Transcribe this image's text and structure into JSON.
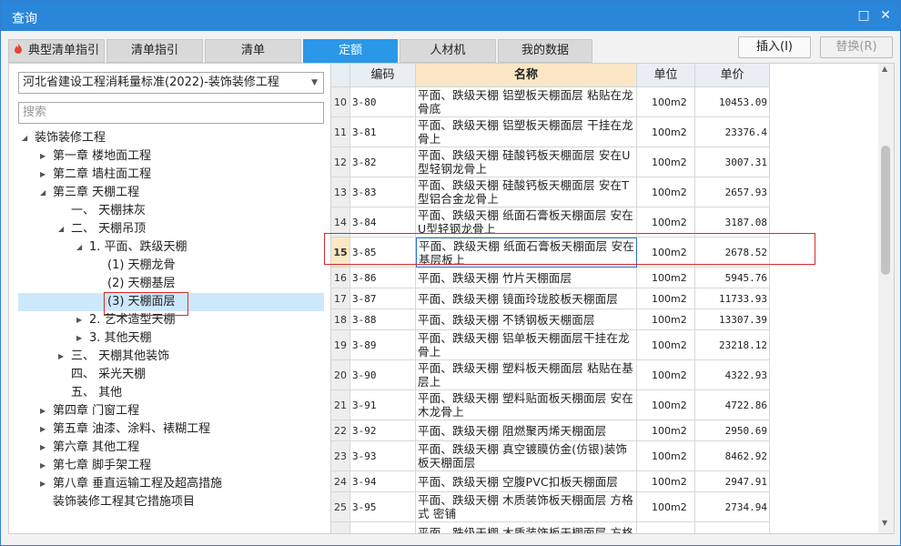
{
  "window": {
    "title": "查询"
  },
  "tabs": [
    {
      "label": "典型清单指引",
      "active": false
    },
    {
      "label": "清单指引",
      "active": false
    },
    {
      "label": "清单",
      "active": false
    },
    {
      "label": "定额",
      "active": true
    },
    {
      "label": "人材机",
      "active": false
    },
    {
      "label": "我的数据",
      "active": false
    }
  ],
  "buttons": {
    "insert": "插入(I)",
    "replace": "替换(R)"
  },
  "left": {
    "select_value": "河北省建设工程消耗量标准(2022)-装饰装修工程",
    "search_placeholder": "搜索",
    "tree": [
      {
        "label": "装饰装修工程",
        "level": 0,
        "toggle": "expanded"
      },
      {
        "label": "第一章 楼地面工程",
        "level": 1,
        "toggle": "collapsed"
      },
      {
        "label": "第二章 墙柱面工程",
        "level": 1,
        "toggle": "collapsed"
      },
      {
        "label": "第三章 天棚工程",
        "level": 1,
        "toggle": "expanded"
      },
      {
        "label": "一、 天棚抹灰",
        "level": 2,
        "toggle": "none"
      },
      {
        "label": "二、 天棚吊顶",
        "level": 2,
        "toggle": "expanded"
      },
      {
        "label": "1. 平面、跌级天棚",
        "level": 3,
        "toggle": "expanded"
      },
      {
        "label": "(1) 天棚龙骨",
        "level": 4,
        "toggle": "none"
      },
      {
        "label": "(2) 天棚基层",
        "level": 4,
        "toggle": "none"
      },
      {
        "label": "(3) 天棚面层",
        "level": 4,
        "toggle": "none",
        "selected": true
      },
      {
        "label": "2. 艺术造型天棚",
        "level": 3,
        "toggle": "collapsed"
      },
      {
        "label": "3. 其他天棚",
        "level": 3,
        "toggle": "collapsed"
      },
      {
        "label": "三、 天棚其他装饰",
        "level": 2,
        "toggle": "collapsed"
      },
      {
        "label": "四、 采光天棚",
        "level": 2,
        "toggle": "none"
      },
      {
        "label": "五、 其他",
        "level": 2,
        "toggle": "none"
      },
      {
        "label": "第四章 门窗工程",
        "level": 1,
        "toggle": "collapsed"
      },
      {
        "label": "第五章 油漆、涂料、裱糊工程",
        "level": 1,
        "toggle": "collapsed"
      },
      {
        "label": "第六章 其他工程",
        "level": 1,
        "toggle": "collapsed"
      },
      {
        "label": "第七章 脚手架工程",
        "level": 1,
        "toggle": "collapsed"
      },
      {
        "label": "第八章 垂直运输工程及超高措施",
        "level": 1,
        "toggle": "collapsed"
      },
      {
        "label": "装饰装修工程其它措施项目",
        "level": 1,
        "toggle": "none"
      }
    ]
  },
  "grid": {
    "headers": {
      "code": "编码",
      "name": "名称",
      "unit": "单位",
      "price": "单价"
    },
    "rows": [
      {
        "idx": "10",
        "code": "3-80",
        "name": "平面、跌级天棚 铝塑板天棚面层 粘贴在龙骨底",
        "unit": "100m2",
        "price": "10453.09"
      },
      {
        "idx": "11",
        "code": "3-81",
        "name": "平面、跌级天棚 铝塑板天棚面层 干挂在龙骨上",
        "unit": "100m2",
        "price": "23376.4"
      },
      {
        "idx": "12",
        "code": "3-82",
        "name": "平面、跌级天棚 硅酸钙板天棚面层 安在U型轻钢龙骨上",
        "unit": "100m2",
        "price": "3007.31"
      },
      {
        "idx": "13",
        "code": "3-83",
        "name": "平面、跌级天棚 硅酸钙板天棚面层 安在T型铝合金龙骨上",
        "unit": "100m2",
        "price": "2657.93"
      },
      {
        "idx": "14",
        "code": "3-84",
        "name": "平面、跌级天棚 纸面石膏板天棚面层 安在U型轻钢龙骨上",
        "unit": "100m2",
        "price": "3187.08"
      },
      {
        "idx": "15",
        "code": "3-85",
        "name": "平面、跌级天棚 纸面石膏板天棚面层 安在基层板上",
        "unit": "100m2",
        "price": "2678.52",
        "selected": true
      },
      {
        "idx": "16",
        "code": "3-86",
        "name": "平面、跌级天棚 竹片天棚面层",
        "unit": "100m2",
        "price": "5945.76"
      },
      {
        "idx": "17",
        "code": "3-87",
        "name": "平面、跌级天棚 镜面玲珑胶板天棚面层",
        "unit": "100m2",
        "price": "11733.93"
      },
      {
        "idx": "18",
        "code": "3-88",
        "name": "平面、跌级天棚 不锈钢板天棚面层",
        "unit": "100m2",
        "price": "13307.39"
      },
      {
        "idx": "19",
        "code": "3-89",
        "name": "平面、跌级天棚 铝单板天棚面层干挂在龙骨上",
        "unit": "100m2",
        "price": "23218.12"
      },
      {
        "idx": "20",
        "code": "3-90",
        "name": "平面、跌级天棚 塑料板天棚面层 粘贴在基层上",
        "unit": "100m2",
        "price": "4322.93"
      },
      {
        "idx": "21",
        "code": "3-91",
        "name": "平面、跌级天棚 塑料贴面板天棚面层 安在木龙骨上",
        "unit": "100m2",
        "price": "4722.86"
      },
      {
        "idx": "22",
        "code": "3-92",
        "name": "平面、跌级天棚 阻燃聚丙烯天棚面层",
        "unit": "100m2",
        "price": "2950.69"
      },
      {
        "idx": "23",
        "code": "3-93",
        "name": "平面、跌级天棚 真空镀膜仿金(仿银)装饰板天棚面层",
        "unit": "100m2",
        "price": "8462.92"
      },
      {
        "idx": "24",
        "code": "3-94",
        "name": "平面、跌级天棚 空腹PVC扣板天棚面层",
        "unit": "100m2",
        "price": "2947.91"
      },
      {
        "idx": "25",
        "code": "3-95",
        "name": "平面、跌级天棚 木质装饰板天棚面层 方格式 密铺",
        "unit": "100m2",
        "price": "2734.94"
      },
      {
        "idx": "",
        "code": "",
        "name": "平面、跌级天棚 木质装饰板天棚面层 方格",
        "unit": "",
        "price": ""
      }
    ]
  }
}
